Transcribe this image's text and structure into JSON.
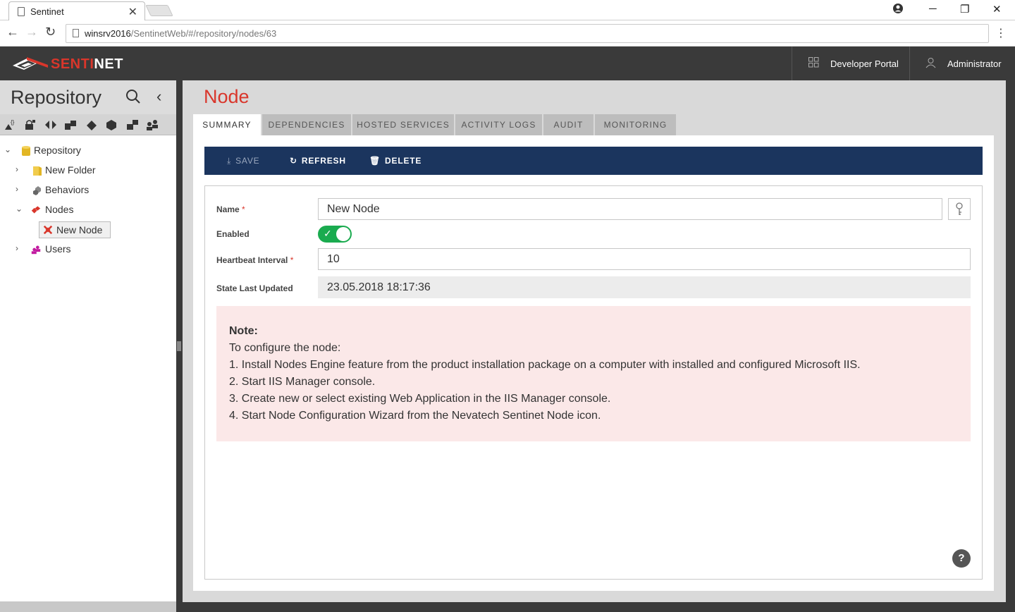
{
  "browser": {
    "tab_title": "Sentinet",
    "url_host": "winsrv2016",
    "url_path": "/SentinetWeb/#/repository/nodes/63"
  },
  "header": {
    "logo_part1": "SENTI",
    "logo_part2": "NET",
    "developer_portal": "Developer Portal",
    "user": "Administrator"
  },
  "sidebar": {
    "title": "Repository",
    "tree": {
      "root": "Repository",
      "items": [
        "New Folder",
        "Behaviors",
        "Nodes",
        "New Node",
        "Users"
      ]
    }
  },
  "main": {
    "title": "Node",
    "tabs": [
      "SUMMARY",
      "DEPENDENCIES",
      "HOSTED SERVICES",
      "ACTIVITY LOGS",
      "AUDIT",
      "MONITORING"
    ],
    "toolbar": {
      "save": "SAVE",
      "refresh": "REFRESH",
      "delete": "DELETE"
    },
    "form": {
      "name_label": "Name",
      "name_value": "New Node",
      "enabled_label": "Enabled",
      "enabled": true,
      "heartbeat_label": "Heartbeat Interval",
      "heartbeat_value": "10",
      "state_label": "State Last Updated",
      "state_value": "23.05.2018 18:17:36",
      "required_mark": "*"
    },
    "note": {
      "title": "Note:",
      "lines": [
        "To configure the node:",
        "1. Install Nodes Engine feature from the product installation package on a computer with installed and configured Microsoft IIS.",
        "2. Start IIS Manager console.",
        "3. Create new or select existing Web Application in the IIS Manager console.",
        "4. Start Node Configuration Wizard from the Nevatech Sentinet Node icon."
      ]
    },
    "help": "?"
  },
  "colors": {
    "accent": "#d9362b",
    "toolbar": "#1b355e",
    "toggle_on": "#1aab4f",
    "note_bg": "#fbe8e8"
  }
}
